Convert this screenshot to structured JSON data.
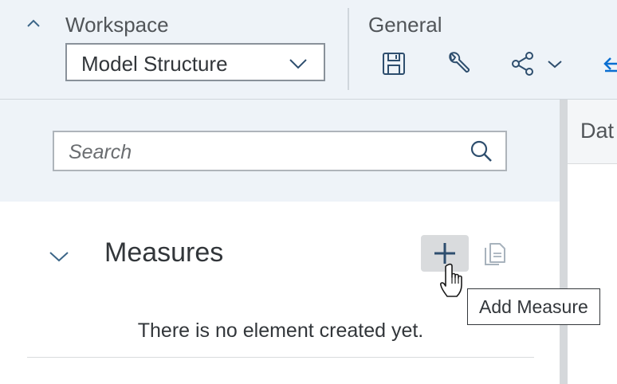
{
  "toolbar": {
    "collapse_icon": "chevron-up-icon",
    "workspace": {
      "label": "Workspace",
      "selected": "Model Structure",
      "arrow_icon": "chevron-down-icon"
    },
    "general": {
      "label": "General",
      "icons": [
        "save-icon",
        "wrench-icon",
        "share-icon",
        "chevron-down-icon",
        "back-icon"
      ]
    }
  },
  "sidebar": {
    "search": {
      "placeholder": "Search",
      "value": "",
      "icon": "search-icon"
    },
    "section": {
      "title": "Measures",
      "expand_icon": "chevron-down-icon",
      "add_icon": "add-icon",
      "copy_icon": "copy-icon",
      "empty_text": "There is no element created yet."
    }
  },
  "right_panel": {
    "tab_label": "Dat"
  },
  "tooltip": {
    "text": "Add Measure"
  },
  "colors": {
    "toolbar_bg": "#eef3f8",
    "accent": "#0a6ed1",
    "icon_blue": "#2e4e6e",
    "text": "#32363a",
    "button_hover_bg": "#d9dbdd"
  }
}
